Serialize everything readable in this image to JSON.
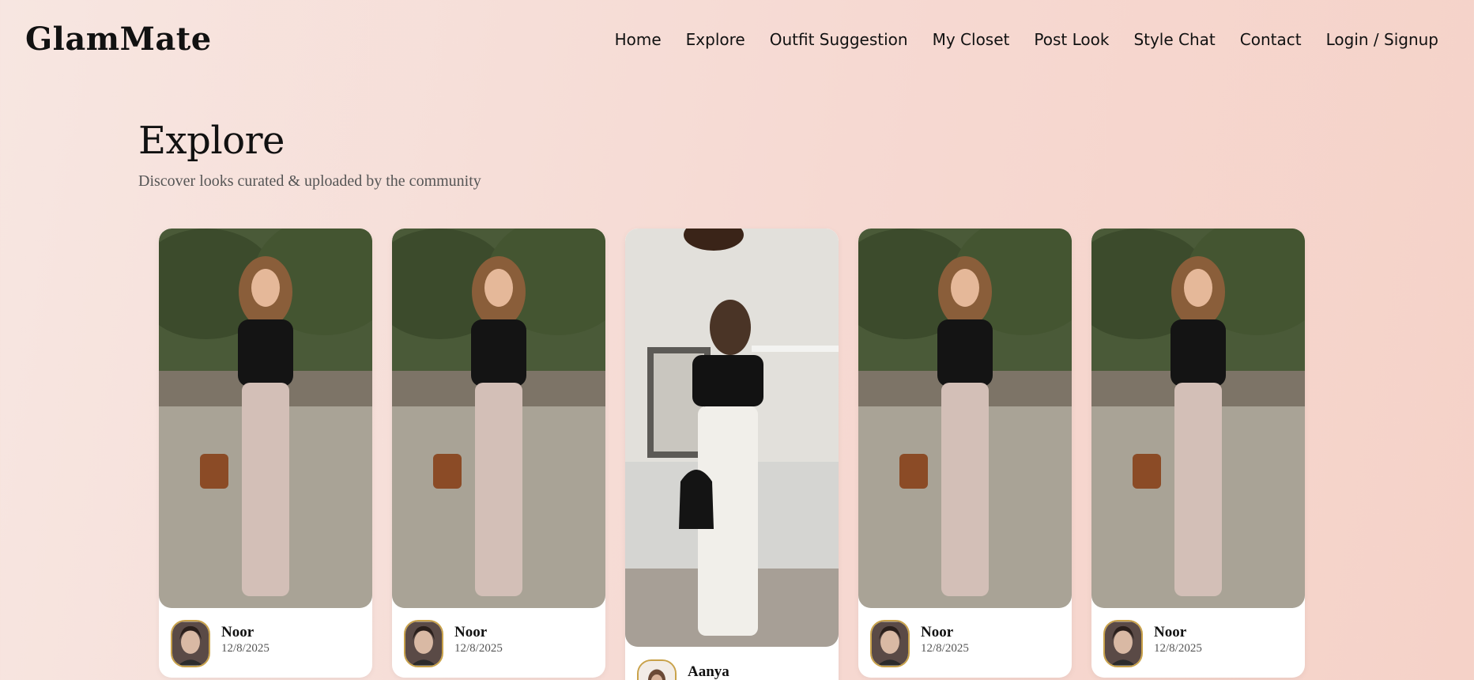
{
  "brand": "GlamMate",
  "nav": {
    "items": [
      {
        "label": "Home"
      },
      {
        "label": "Explore"
      },
      {
        "label": "Outfit Suggestion"
      },
      {
        "label": "My Closet"
      },
      {
        "label": "Post Look"
      },
      {
        "label": "Style Chat"
      },
      {
        "label": "Contact"
      },
      {
        "label": "Login / Signup"
      }
    ]
  },
  "page": {
    "title": "Explore",
    "subtitle": "Discover looks curated & uploaded by the community"
  },
  "looks": [
    {
      "author": "Noor",
      "date": "12/8/2025"
    },
    {
      "author": "Noor",
      "date": "12/8/2025"
    },
    {
      "author": "Aanya",
      "date": ""
    },
    {
      "author": "Noor",
      "date": "12/8/2025"
    },
    {
      "author": "Noor",
      "date": "12/8/2025"
    }
  ],
  "colors": {
    "accent_border": "#c9a24a",
    "text": "#111111",
    "muted": "#555555"
  }
}
